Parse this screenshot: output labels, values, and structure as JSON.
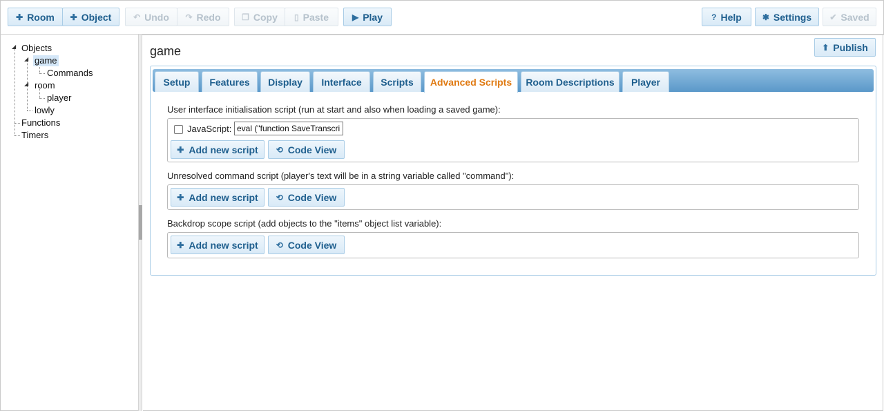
{
  "toolbar": {
    "room": "Room",
    "object": "Object",
    "undo": "Undo",
    "redo": "Redo",
    "copy": "Copy",
    "paste": "Paste",
    "play": "Play",
    "help": "Help",
    "settings": "Settings",
    "saved": "Saved"
  },
  "tree": {
    "objects": "Objects",
    "game": "game",
    "commands": "Commands",
    "room": "room",
    "player": "player",
    "lowly": "lowly",
    "functions": "Functions",
    "timers": "Timers"
  },
  "main": {
    "title": "game",
    "publish": "Publish",
    "tabs": [
      "Setup",
      "Features",
      "Display",
      "Interface",
      "Scripts",
      "Advanced Scripts",
      "Room Descriptions",
      "Player"
    ],
    "active_tab": "Advanced Scripts",
    "sections": [
      {
        "label": "User interface initialisation script (run at start and also when loading a saved game):",
        "js_label": "JavaScript:",
        "js_value": "eval (\"function SaveTranscri",
        "add_label": "Add new script",
        "code_label": "Code View"
      },
      {
        "label": "Unresolved command script (player's text will be in a string variable called \"command\"):",
        "add_label": "Add new script",
        "code_label": "Code View"
      },
      {
        "label": "Backdrop scope script (add objects to the \"items\" object list variable):",
        "add_label": "Add new script",
        "code_label": "Code View"
      }
    ]
  }
}
